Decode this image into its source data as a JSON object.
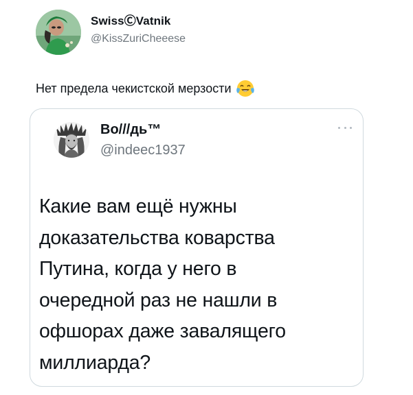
{
  "tweet": {
    "author": {
      "display_name": "SwissⒸVatnik",
      "handle": "@KissZuriCheeese",
      "avatar": "woman-in-green-avatar-icon"
    },
    "text": "Нет предела чекистской мерзости",
    "emoji": "face-with-tears-of-joy-icon"
  },
  "quoted_tweet": {
    "author": {
      "display_name": "Во///дь™",
      "handle": "@indeec1937",
      "avatar": "engraved-portrait-avatar-icon"
    },
    "menu_icon": "more-dots-icon",
    "text_lines": [
      "Какие вам ещё нужны",
      "доказательства коварства",
      "Путина, когда у него в",
      "очередной раз не нашли в",
      "офшорах даже завалящего",
      "миллиарда?"
    ]
  },
  "colors": {
    "text": "#0f1419",
    "secondary_text": "#6e767d",
    "card_border": "#cfd9de",
    "avatar_bg": "#8fb99a"
  }
}
